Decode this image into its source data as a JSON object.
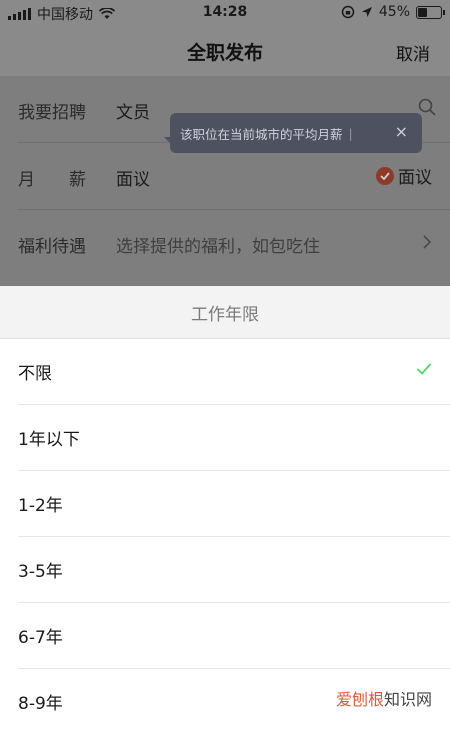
{
  "status_bar": {
    "carrier": "中国移动",
    "time": "14:28",
    "battery": "45%",
    "battery_level": 0.45
  },
  "nav": {
    "title": "全职发布",
    "cancel_label": "取消"
  },
  "form": {
    "position_label": "我要招聘",
    "position_value": "文员",
    "salary_label": "月　　薪",
    "salary_value": "面议",
    "negotiable_label": "面议",
    "benefits_label": "福利待遇",
    "benefits_placeholder": "选择提供的福利，如包吃住"
  },
  "tooltip": {
    "text": "该职位在当前城市的平均月薪",
    "separator": "|",
    "close": "×"
  },
  "sheet": {
    "title": "工作年限",
    "options": [
      "不限",
      "1年以下",
      "1-2年",
      "3-5年",
      "6-7年",
      "8-9年"
    ],
    "selected_index": 0
  },
  "watermark": {
    "brand": "爱刨根",
    "suffix": "知识网"
  },
  "colors": {
    "accent_check": "#4cd964",
    "negotiable_badge": "#8e3a2a"
  }
}
